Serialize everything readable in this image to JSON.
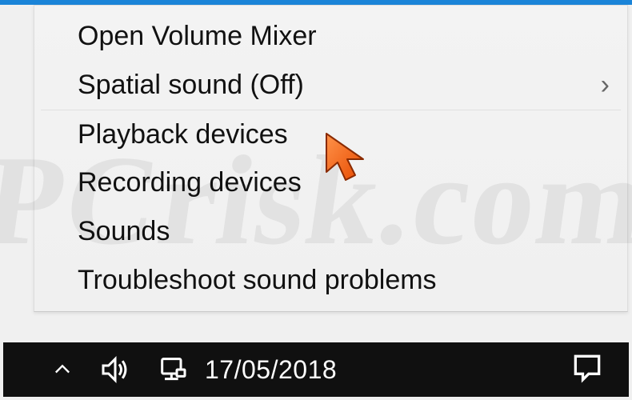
{
  "menu": {
    "items": [
      {
        "label": "Open Volume Mixer",
        "has_submenu": false
      },
      {
        "label": "Spatial sound (Off)",
        "has_submenu": true
      },
      {
        "label": "Playback devices",
        "has_submenu": false
      },
      {
        "label": "Recording devices",
        "has_submenu": false
      },
      {
        "label": "Sounds",
        "has_submenu": false
      },
      {
        "label": "Troubleshoot sound problems",
        "has_submenu": false
      }
    ],
    "submenu_glyph": "›"
  },
  "taskbar": {
    "date": "17/05/2018"
  },
  "watermark": {
    "text": "PCrisk.com"
  },
  "colors": {
    "accent": "#1a84d8",
    "cursor": "#ff6a13"
  }
}
